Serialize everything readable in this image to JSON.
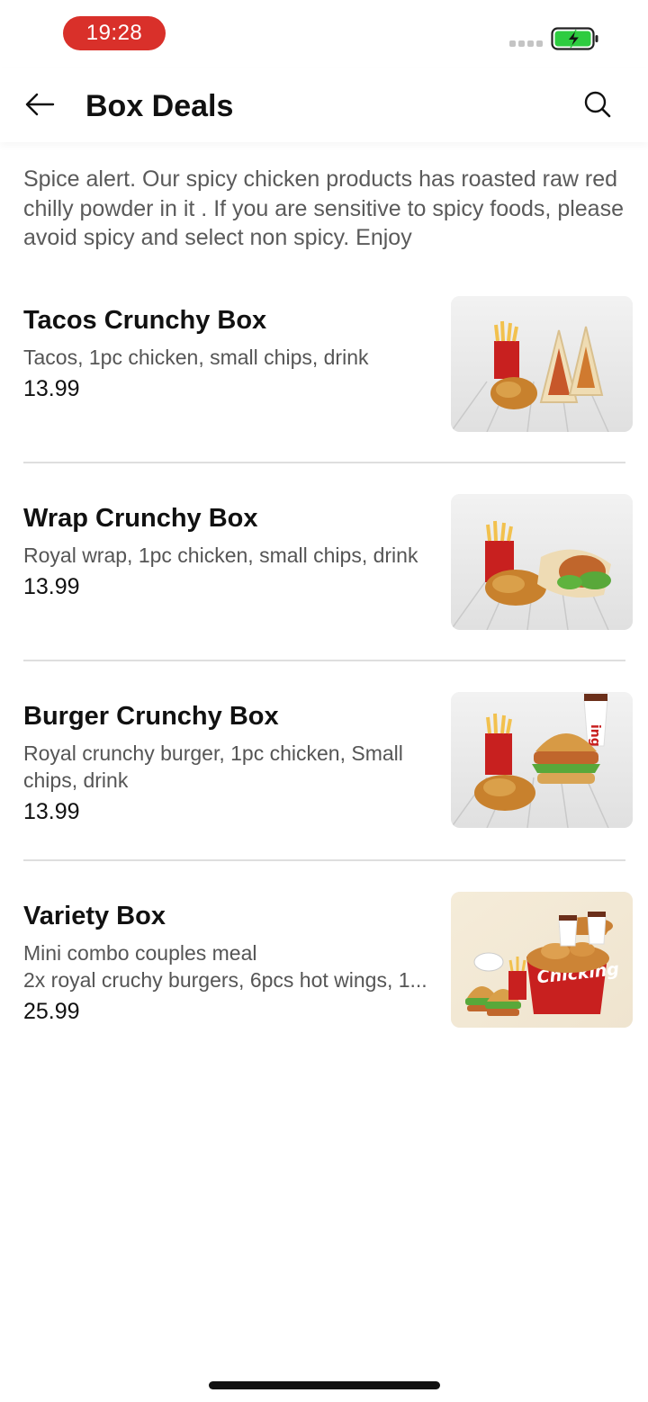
{
  "status_bar": {
    "time": "19:28",
    "battery_icon": "battery-charging-icon",
    "colors": {
      "time_pill": "#d9302a",
      "battery": "#2ecc40"
    }
  },
  "header": {
    "title": "Box Deals",
    "back_icon": "arrow-left-icon",
    "search_icon": "search-icon"
  },
  "notice": "Spice alert. Our spicy chicken products has roasted raw red chilly powder in it . If you are sensitive to spicy foods, please avoid spicy and select non spicy. Enjoy",
  "deals": [
    {
      "name": "Tacos Crunchy Box",
      "description": [
        "Tacos, 1pc chicken, small chips, drink"
      ],
      "price": "13.99"
    },
    {
      "name": "Wrap Crunchy Box",
      "description": [
        "Royal wrap, 1pc chicken, small chips, drink"
      ],
      "price": "13.99"
    },
    {
      "name": "Burger Crunchy Box",
      "description": [
        "Royal crunchy burger, 1pc chicken, Small",
        "chips, drink"
      ],
      "price": "13.99"
    },
    {
      "name": "Variety Box",
      "description": [
        "Mini combo couples meal",
        "2x royal cruchy burgers, 6pcs hot wings, 1..."
      ],
      "price": "25.99"
    }
  ],
  "brand_cup_text": "Chicking",
  "colors": {
    "brand_red": "#c8201f",
    "text": "#111111",
    "muted": "#555555"
  }
}
